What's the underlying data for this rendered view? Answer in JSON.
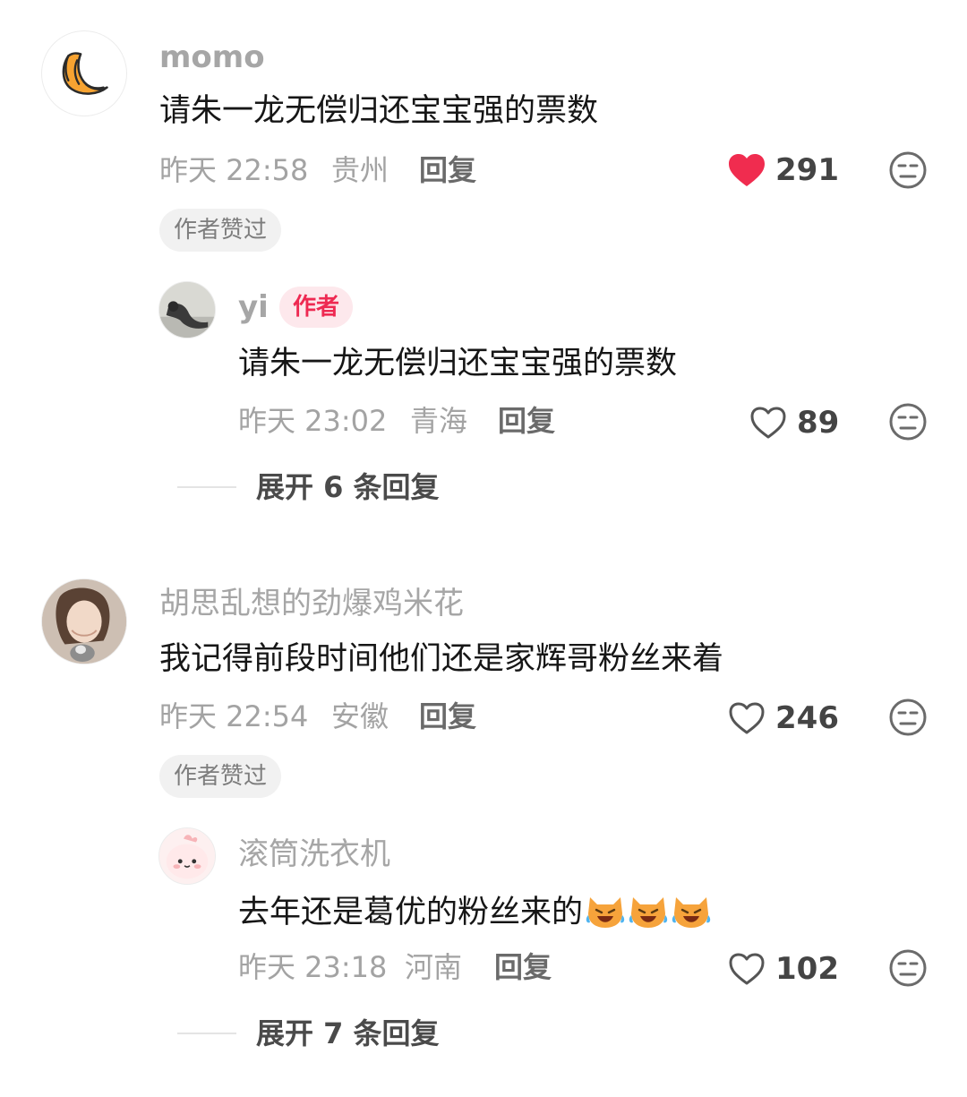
{
  "comments": [
    {
      "user": "momo",
      "text": "请朱一龙无偿归还宝宝强的票数",
      "time": "昨天 22:58",
      "location": "贵州",
      "reply_label": "回复",
      "likes": "291",
      "liked": true,
      "badge": "作者赞过",
      "avatar_icon": "croissant-icon",
      "replies": [
        {
          "user": "yi",
          "author_tag": "作者",
          "text": "请朱一龙无偿归还宝宝强的票数",
          "time": "昨天 23:02",
          "location": "青海",
          "reply_label": "回复",
          "likes": "89",
          "liked": false
        }
      ],
      "expand_label": "展开 6 条回复"
    },
    {
      "user": "胡思乱想的劲爆鸡米花",
      "text": "我记得前段时间他们还是家辉哥粉丝来着",
      "time": "昨天 22:54",
      "location": "安徽",
      "reply_label": "回复",
      "likes": "246",
      "liked": false,
      "badge": "作者赞过",
      "replies": [
        {
          "user": "滚筒洗衣机",
          "text": "去年还是葛优的粉丝来的",
          "emoji": "laughing-cat-emoji",
          "time": "昨天 23:18",
          "location": "河南",
          "reply_label": "回复",
          "likes": "102",
          "liked": false
        }
      ],
      "expand_label": "展开 7 条回复"
    }
  ],
  "colors": {
    "liked_heart": "#f02c4f",
    "author_tag_bg": "#fde8ec",
    "author_tag_text": "#ee2a52"
  }
}
